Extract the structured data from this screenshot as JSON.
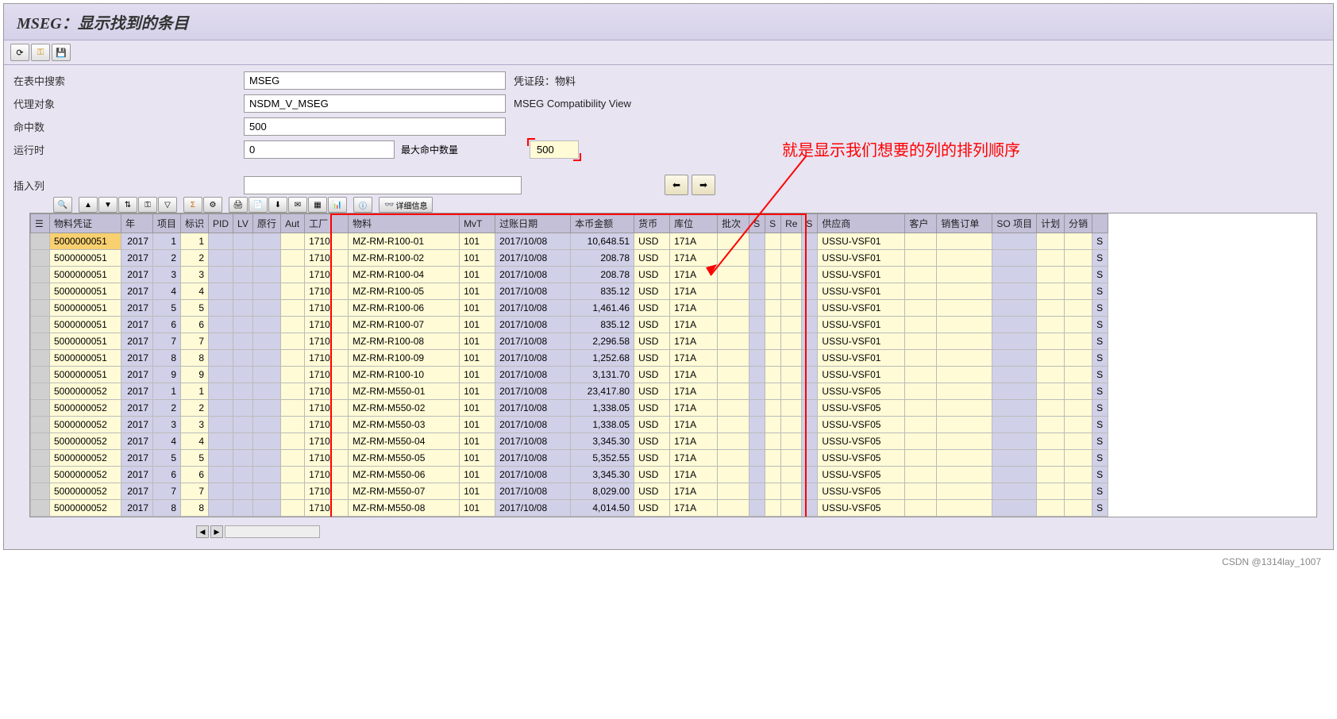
{
  "title": "MSEG：显示找到的条目",
  "form": {
    "search_label": "在表中搜索",
    "search_value": "MSEG",
    "search_desc": "凭证段：物料",
    "proxy_label": "代理对象",
    "proxy_value": "NSDM_V_MSEG",
    "proxy_desc": "MSEG Compatibility View",
    "hits_label": "命中数",
    "hits_value": "500",
    "runtime_label": "运行时",
    "runtime_value": "0",
    "max_label": "最大命中数量",
    "max_value": "500",
    "insert_label": "插入列"
  },
  "annotation_text": "就是显示我们想要的列的排列顺序",
  "toolbar2": {
    "detail": "详细信息"
  },
  "columns": [
    "物料凭证",
    "年",
    "项目",
    "标识",
    "PID",
    "LV",
    "原行",
    "Aut",
    "工厂",
    "物料",
    "MvT",
    "过账日期",
    "本币金额",
    "货币",
    "库位",
    "批次",
    "S",
    "S",
    "Re",
    "S",
    "供应商",
    "客户",
    "销售订单",
    "SO 项目",
    "计划",
    "分销",
    ""
  ],
  "rows": [
    {
      "doc": "5000000051",
      "year": "2017",
      "item": "1",
      "mark": "1",
      "plant": "1710",
      "mat": "MZ-RM-R100-01",
      "mvt": "101",
      "date": "2017/10/08",
      "amt": "10,648.51",
      "curr": "USD",
      "loc": "171A",
      "vendor": "USSU-VSF01",
      "last": "S"
    },
    {
      "doc": "5000000051",
      "year": "2017",
      "item": "2",
      "mark": "2",
      "plant": "1710",
      "mat": "MZ-RM-R100-02",
      "mvt": "101",
      "date": "2017/10/08",
      "amt": "208.78",
      "curr": "USD",
      "loc": "171A",
      "vendor": "USSU-VSF01",
      "last": "S"
    },
    {
      "doc": "5000000051",
      "year": "2017",
      "item": "3",
      "mark": "3",
      "plant": "1710",
      "mat": "MZ-RM-R100-04",
      "mvt": "101",
      "date": "2017/10/08",
      "amt": "208.78",
      "curr": "USD",
      "loc": "171A",
      "vendor": "USSU-VSF01",
      "last": "S"
    },
    {
      "doc": "5000000051",
      "year": "2017",
      "item": "4",
      "mark": "4",
      "plant": "1710",
      "mat": "MZ-RM-R100-05",
      "mvt": "101",
      "date": "2017/10/08",
      "amt": "835.12",
      "curr": "USD",
      "loc": "171A",
      "vendor": "USSU-VSF01",
      "last": "S"
    },
    {
      "doc": "5000000051",
      "year": "2017",
      "item": "5",
      "mark": "5",
      "plant": "1710",
      "mat": "MZ-RM-R100-06",
      "mvt": "101",
      "date": "2017/10/08",
      "amt": "1,461.46",
      "curr": "USD",
      "loc": "171A",
      "vendor": "USSU-VSF01",
      "last": "S"
    },
    {
      "doc": "5000000051",
      "year": "2017",
      "item": "6",
      "mark": "6",
      "plant": "1710",
      "mat": "MZ-RM-R100-07",
      "mvt": "101",
      "date": "2017/10/08",
      "amt": "835.12",
      "curr": "USD",
      "loc": "171A",
      "vendor": "USSU-VSF01",
      "last": "S"
    },
    {
      "doc": "5000000051",
      "year": "2017",
      "item": "7",
      "mark": "7",
      "plant": "1710",
      "mat": "MZ-RM-R100-08",
      "mvt": "101",
      "date": "2017/10/08",
      "amt": "2,296.58",
      "curr": "USD",
      "loc": "171A",
      "vendor": "USSU-VSF01",
      "last": "S"
    },
    {
      "doc": "5000000051",
      "year": "2017",
      "item": "8",
      "mark": "8",
      "plant": "1710",
      "mat": "MZ-RM-R100-09",
      "mvt": "101",
      "date": "2017/10/08",
      "amt": "1,252.68",
      "curr": "USD",
      "loc": "171A",
      "vendor": "USSU-VSF01",
      "last": "S"
    },
    {
      "doc": "5000000051",
      "year": "2017",
      "item": "9",
      "mark": "9",
      "plant": "1710",
      "mat": "MZ-RM-R100-10",
      "mvt": "101",
      "date": "2017/10/08",
      "amt": "3,131.70",
      "curr": "USD",
      "loc": "171A",
      "vendor": "USSU-VSF01",
      "last": "S"
    },
    {
      "doc": "5000000052",
      "year": "2017",
      "item": "1",
      "mark": "1",
      "plant": "1710",
      "mat": "MZ-RM-M550-01",
      "mvt": "101",
      "date": "2017/10/08",
      "amt": "23,417.80",
      "curr": "USD",
      "loc": "171A",
      "vendor": "USSU-VSF05",
      "last": "S"
    },
    {
      "doc": "5000000052",
      "year": "2017",
      "item": "2",
      "mark": "2",
      "plant": "1710",
      "mat": "MZ-RM-M550-02",
      "mvt": "101",
      "date": "2017/10/08",
      "amt": "1,338.05",
      "curr": "USD",
      "loc": "171A",
      "vendor": "USSU-VSF05",
      "last": "S"
    },
    {
      "doc": "5000000052",
      "year": "2017",
      "item": "3",
      "mark": "3",
      "plant": "1710",
      "mat": "MZ-RM-M550-03",
      "mvt": "101",
      "date": "2017/10/08",
      "amt": "1,338.05",
      "curr": "USD",
      "loc": "171A",
      "vendor": "USSU-VSF05",
      "last": "S"
    },
    {
      "doc": "5000000052",
      "year": "2017",
      "item": "4",
      "mark": "4",
      "plant": "1710",
      "mat": "MZ-RM-M550-04",
      "mvt": "101",
      "date": "2017/10/08",
      "amt": "3,345.30",
      "curr": "USD",
      "loc": "171A",
      "vendor": "USSU-VSF05",
      "last": "S"
    },
    {
      "doc": "5000000052",
      "year": "2017",
      "item": "5",
      "mark": "5",
      "plant": "1710",
      "mat": "MZ-RM-M550-05",
      "mvt": "101",
      "date": "2017/10/08",
      "amt": "5,352.55",
      "curr": "USD",
      "loc": "171A",
      "vendor": "USSU-VSF05",
      "last": "S"
    },
    {
      "doc": "5000000052",
      "year": "2017",
      "item": "6",
      "mark": "6",
      "plant": "1710",
      "mat": "MZ-RM-M550-06",
      "mvt": "101",
      "date": "2017/10/08",
      "amt": "3,345.30",
      "curr": "USD",
      "loc": "171A",
      "vendor": "USSU-VSF05",
      "last": "S"
    },
    {
      "doc": "5000000052",
      "year": "2017",
      "item": "7",
      "mark": "7",
      "plant": "1710",
      "mat": "MZ-RM-M550-07",
      "mvt": "101",
      "date": "2017/10/08",
      "amt": "8,029.00",
      "curr": "USD",
      "loc": "171A",
      "vendor": "USSU-VSF05",
      "last": "S"
    },
    {
      "doc": "5000000052",
      "year": "2017",
      "item": "8",
      "mark": "8",
      "plant": "1710",
      "mat": "MZ-RM-M550-08",
      "mvt": "101",
      "date": "2017/10/08",
      "amt": "4,014.50",
      "curr": "USD",
      "loc": "171A",
      "vendor": "USSU-VSF05",
      "last": "S"
    }
  ],
  "footer": "CSDN @1314lay_1007"
}
